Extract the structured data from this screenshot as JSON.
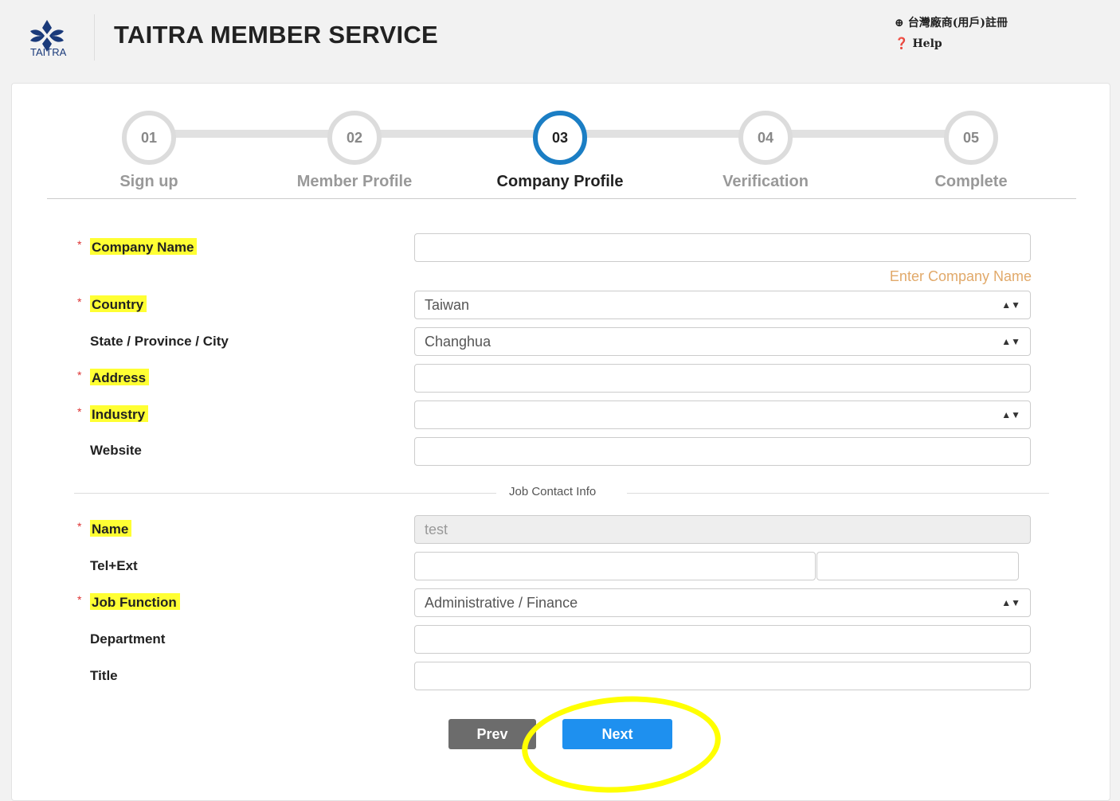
{
  "header": {
    "logo_text": "TAITRA",
    "title": "TAITRA MEMBER SERVICE",
    "register_link": "台灣廠商(用戶)註冊",
    "help_link": "Help"
  },
  "steps": [
    {
      "num": "01",
      "label": "Sign up"
    },
    {
      "num": "02",
      "label": "Member Profile"
    },
    {
      "num": "03",
      "label": "Company Profile"
    },
    {
      "num": "04",
      "label": "Verification"
    },
    {
      "num": "05",
      "label": "Complete"
    }
  ],
  "active_step_color": "#1b7ec4",
  "form": {
    "company_name": {
      "label": "Company Name",
      "value": "",
      "hint": "Enter Company Name"
    },
    "country": {
      "label": "Country",
      "value": "Taiwan"
    },
    "state": {
      "label": "State / Province / City",
      "value": "Changhua"
    },
    "address": {
      "label": "Address",
      "value": ""
    },
    "industry": {
      "label": "Industry",
      "value": ""
    },
    "website": {
      "label": "Website",
      "value": ""
    },
    "section_title": "Job Contact Info",
    "name": {
      "label": "Name",
      "value": "test"
    },
    "tel": {
      "label": "Tel+Ext",
      "value": "",
      "ext": ""
    },
    "job_function": {
      "label": "Job Function",
      "value": "Administrative / Finance"
    },
    "department": {
      "label": "Department",
      "value": ""
    },
    "title_field": {
      "label": "Title",
      "value": ""
    }
  },
  "buttons": {
    "prev": "Prev",
    "next": "Next"
  },
  "highlight_color": "#ffff33",
  "required_mark": "*"
}
